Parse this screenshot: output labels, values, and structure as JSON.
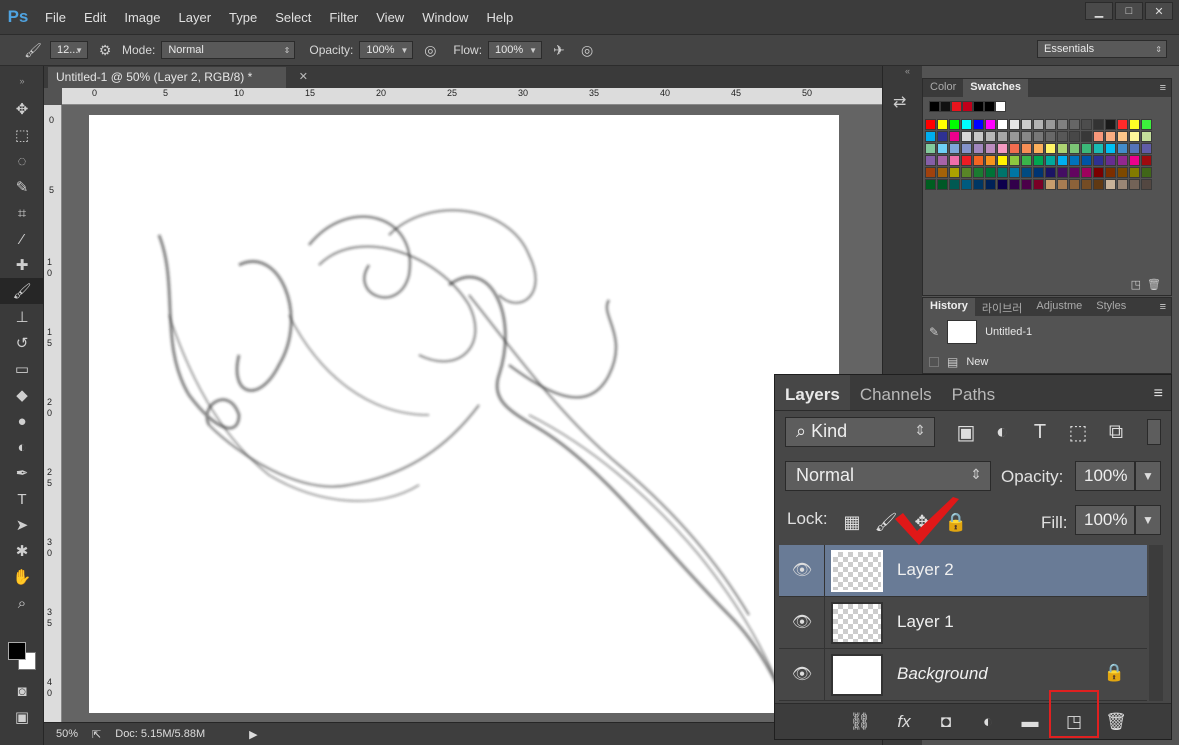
{
  "menubar": {
    "logo": "Ps",
    "items": [
      "File",
      "Edit",
      "Image",
      "Layer",
      "Type",
      "Select",
      "Filter",
      "View",
      "Window",
      "Help"
    ]
  },
  "options": {
    "brush_size": "12...",
    "mode_label": "Mode:",
    "mode_value": "Normal",
    "opacity_label": "Opacity:",
    "opacity_value": "100%",
    "flow_label": "Flow:",
    "flow_value": "100%",
    "workspace": "Essentials"
  },
  "document": {
    "tab_title": "Untitled-1 @ 50% (Layer 2, RGB/8) *",
    "ruler_h": [
      "0",
      "5",
      "10",
      "15",
      "20",
      "25",
      "30",
      "35",
      "40",
      "45",
      "50"
    ],
    "ruler_v": [
      "0",
      "5",
      "1 0",
      "1 5",
      "2 0",
      "2 5",
      "3 0",
      "3 5",
      "4 0"
    ],
    "zoom": "50%",
    "doc_size": "Doc: 5.15M/5.88M"
  },
  "swatches_panel": {
    "tabs": [
      "Color",
      "Swatches"
    ],
    "active_tab": "Swatches"
  },
  "history_panel": {
    "tabs": [
      "History",
      "라이브러",
      "Adjustme",
      "Styles"
    ],
    "active_tab": "History",
    "entries": [
      "Untitled-1",
      "New"
    ]
  },
  "layers_panel": {
    "tabs": [
      "Layers",
      "Channels",
      "Paths"
    ],
    "active_tab": "Layers",
    "filter_kind": "Kind",
    "blend_mode": "Normal",
    "opacity_label": "Opacity:",
    "opacity_value": "100%",
    "lock_label": "Lock:",
    "fill_label": "Fill:",
    "fill_value": "100%",
    "layers": [
      {
        "name": "Layer 2",
        "selected": true
      },
      {
        "name": "Layer 1",
        "selected": false
      },
      {
        "name": "Background",
        "selected": false,
        "locked": true
      }
    ]
  },
  "colors": {
    "accent_selected_layer": "#697b96",
    "highlight_red": "#e02020"
  }
}
